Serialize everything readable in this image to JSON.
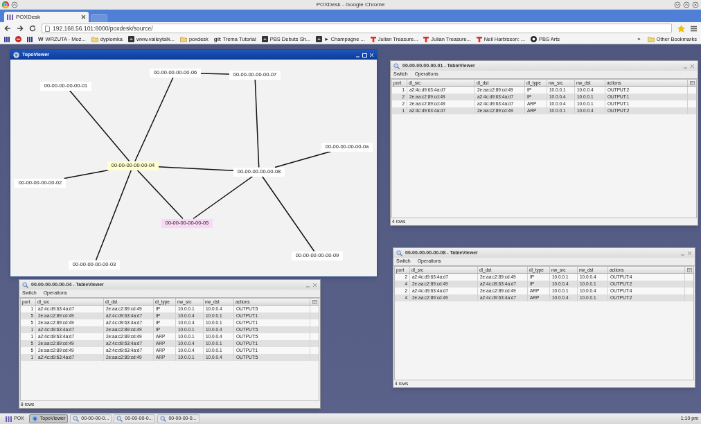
{
  "browser": {
    "title": "POXDesk - Google Chrome",
    "tab": "POXDesk",
    "url": "192.168.56.101:8000/poxdesk/source/"
  },
  "bookmarks": [
    {
      "kind": "pox"
    },
    {
      "kind": "round"
    },
    {
      "kind": "pox"
    },
    {
      "kind": "site",
      "icon_text": "W",
      "label": "WRZUTA - Moż..."
    },
    {
      "kind": "folder",
      "label": "dyplomka"
    },
    {
      "kind": "site",
      "label": "www.valleytalk..."
    },
    {
      "kind": "folder",
      "label": "poxdesk"
    },
    {
      "kind": "site",
      "icon_text": "git",
      "label": "Trema Tutorial"
    },
    {
      "kind": "site",
      "label": "PBS Debuts Sh..."
    },
    {
      "kind": "site",
      "label": "► Champagne ..."
    },
    {
      "kind": "ted",
      "label": "Julian Treasure..."
    },
    {
      "kind": "ted",
      "label": "Julian Treasure..."
    },
    {
      "kind": "ted",
      "label": "Neil Harbisson: ..."
    },
    {
      "kind": "pbs",
      "label": "PBS Arts"
    }
  ],
  "more_bookmarks": "»",
  "other_bookmarks": "Other Bookmarks",
  "topo": {
    "title": "TopoViewer",
    "active": true,
    "nodes": [
      {
        "label": "00-00-00-00-00-06",
        "color": "#ffffff"
      },
      {
        "label": "00-00-00-00-00-07",
        "color": "#ffffff"
      },
      {
        "label": "00-00-00-00-00-01",
        "color": "#ffffff"
      },
      {
        "label": "00-00-00-00-00-0a",
        "color": "#ffffff"
      },
      {
        "label": "00-00-00-00-00-04",
        "color": "#ffffd0"
      },
      {
        "label": "00-00-00-00-00-08",
        "color": "#ffffff"
      },
      {
        "label": "00-00-00-00-00-02",
        "color": "#ffffff"
      },
      {
        "label": "00-00-00-00-00-05",
        "color": "#f8d8f4"
      },
      {
        "label": "00-00-00-00-00-09",
        "color": "#ffffff"
      },
      {
        "label": "00-00-00-00-00-03",
        "color": "#ffffff"
      }
    ]
  },
  "tables": [
    {
      "title": "00-00-00-00-00-01 - TableViewer",
      "active": false,
      "menu": [
        "Switch",
        "Operations"
      ],
      "columns": [
        "port",
        "dl_src",
        "dl_dst",
        "dl_type",
        "nw_src",
        "nw_dst",
        "actions"
      ],
      "rows": [
        [
          "1",
          "a2:4c:d9:63:4a:d7",
          "2e:aa:c2:89:cd:49",
          "IP",
          "10.0.0.1",
          "10.0.0.4",
          "OUTPUT:2"
        ],
        [
          "2",
          "2e:aa:c2:89:cd:49",
          "a2:4c:d9:63:4a:d7",
          "IP",
          "10.0.0.4",
          "10.0.0.1",
          "OUTPUT:1"
        ],
        [
          "2",
          "2e:aa:c2:89:cd:49",
          "a2:4c:d9:63:4a:d7",
          "ARP",
          "10.0.0.4",
          "10.0.0.1",
          "OUTPUT:1"
        ],
        [
          "1",
          "a2:4c:d9:63:4a:d7",
          "2e:aa:c2:89:cd:49",
          "ARP",
          "10.0.0.1",
          "10.0.0.4",
          "OUTPUT:2"
        ]
      ],
      "footer": "4 rows"
    },
    {
      "title": "00-00-00-00-00-08 - TableViewer",
      "active": false,
      "menu": [
        "Switch",
        "Operations"
      ],
      "columns": [
        "port",
        "dl_src",
        "dl_dst",
        "dl_type",
        "nw_src",
        "nw_dst",
        "actions"
      ],
      "rows": [
        [
          "2",
          "a2:4c:d9:63:4a:d7",
          "2e:aa:c2:89:cd:49",
          "IP",
          "10.0.0.1",
          "10.0.0.4",
          "OUTPUT:4"
        ],
        [
          "4",
          "2e:aa:c2:89:cd:49",
          "a2:4c:d9:63:4a:d7",
          "IP",
          "10.0.0.4",
          "10.0.0.1",
          "OUTPUT:2"
        ],
        [
          "2",
          "a2:4c:d9:63:4a:d7",
          "2e:aa:c2:89:cd:49",
          "ARP",
          "10.0.0.1",
          "10.0.0.4",
          "OUTPUT:4"
        ],
        [
          "4",
          "2e:aa:c2:89:cd:49",
          "a2:4c:d9:63:4a:d7",
          "ARP",
          "10.0.0.4",
          "10.0.0.1",
          "OUTPUT:2"
        ]
      ],
      "footer": "4 rows"
    },
    {
      "title": "00-00-00-00-00-04 - TableViewer",
      "active": false,
      "menu": [
        "Switch",
        "Operations"
      ],
      "columns": [
        "port",
        "dl_src",
        "dl_dst",
        "dl_type",
        "nw_src",
        "nw_dst",
        "actions"
      ],
      "rows": [
        [
          "1",
          "a2:4c:d9:63:4a:d7",
          "2e:aa:c2:89:cd:49",
          "IP",
          "10.0.0.1",
          "10.0.0.4",
          "OUTPUT:5"
        ],
        [
          "5",
          "2e:aa:c2:89:cd:49",
          "a2:4c:d9:63:4a:d7",
          "IP",
          "10.0.0.4",
          "10.0.0.1",
          "OUTPUT:1"
        ],
        [
          "5",
          "2e:aa:c2:89:cd:49",
          "a2:4c:d9:63:4a:d7",
          "IP",
          "10.0.0.4",
          "10.0.0.1",
          "OUTPUT:1"
        ],
        [
          "1",
          "a2:4c:d9:63:4a:d7",
          "2e:aa:c2:89:cd:49",
          "IP",
          "10.0.0.1",
          "10.0.0.4",
          "OUTPUT:5"
        ],
        [
          "1",
          "a2:4c:d9:63:4a:d7",
          "2e:aa:c2:89:cd:49",
          "ARP",
          "10.0.0.1",
          "10.0.0.4",
          "OUTPUT:5"
        ],
        [
          "5",
          "2e:aa:c2:89:cd:49",
          "a2:4c:d9:63:4a:d7",
          "ARP",
          "10.0.0.4",
          "10.0.0.1",
          "OUTPUT:1"
        ],
        [
          "5",
          "2e:aa:c2:89:cd:49",
          "a2:4c:d9:63:4a:d7",
          "ARP",
          "10.0.0.4",
          "10.0.0.1",
          "OUTPUT:1"
        ],
        [
          "1",
          "a2:4c:d9:63:4a:d7",
          "2e:aa:c2:89:cd:49",
          "ARP",
          "10.0.0.1",
          "10.0.0.4",
          "OUTPUT:5"
        ]
      ],
      "footer": "8 rows"
    }
  ],
  "taskbar": {
    "items": [
      {
        "kind": "start",
        "label": "POX",
        "selected": false
      },
      {
        "kind": "topo",
        "label": "TopoViewer",
        "selected": true
      },
      {
        "kind": "table",
        "label": "00-00-00-0...",
        "selected": false
      },
      {
        "kind": "table",
        "label": "00-00-00-0...",
        "selected": false
      },
      {
        "kind": "table",
        "label": "00-00-00-0...",
        "selected": false
      }
    ],
    "clock": "1:10 pm"
  }
}
